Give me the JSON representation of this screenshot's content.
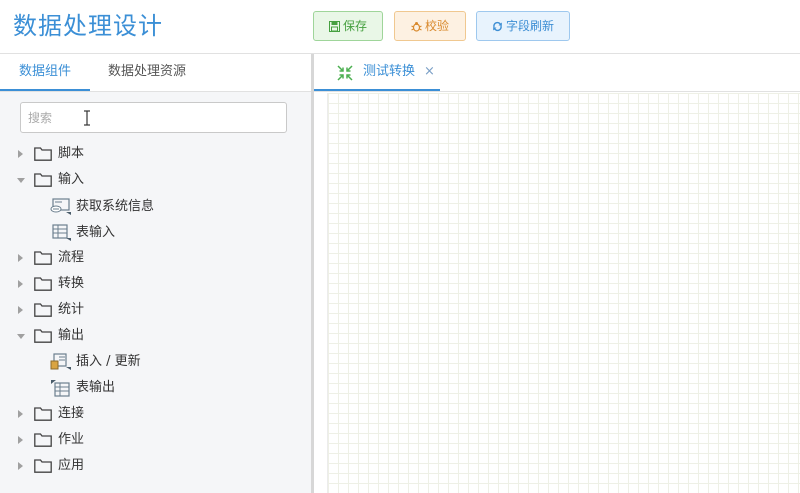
{
  "app": {
    "title": "数据处理设计"
  },
  "toolbar": {
    "save_label": "保存",
    "check_label": "校验",
    "refresh_label": "字段刷新"
  },
  "left_tabs": {
    "components": "数据组件",
    "resources": "数据处理资源"
  },
  "search": {
    "placeholder": "搜索",
    "value": ""
  },
  "tree": {
    "script": "脚本",
    "input": "输入",
    "input_children": {
      "get_system_info": "获取系统信息",
      "table_input": "表输入"
    },
    "flow": "流程",
    "transform": "转换",
    "stats": "统计",
    "output": "输出",
    "output_children": {
      "insert_update": "插入 / 更新",
      "table_output": "表输出"
    },
    "join": "连接",
    "job": "作业",
    "app": "应用"
  },
  "editor_tabs": {
    "active": "测试转换",
    "close_glyph": "×"
  },
  "colors": {
    "accent": "#3b8fd6",
    "save": "#46a040",
    "check": "#d98a2e",
    "refresh": "#3d8ed4",
    "grid": "#eef0e6"
  },
  "icons": {
    "save": "save-icon",
    "check": "bug-icon",
    "refresh": "refresh-icon",
    "folder": "folder-icon",
    "transform": "compress-arrows-icon"
  }
}
